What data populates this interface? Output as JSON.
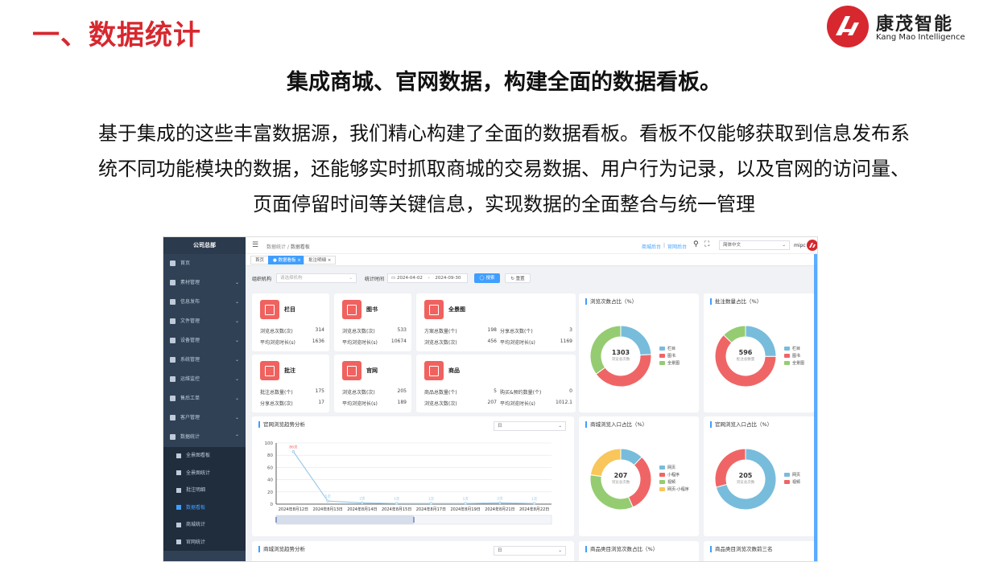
{
  "slide": {
    "title": "一、数据统计",
    "logo_cn": "康茂智能",
    "logo_en": "Kang Mao Intelligence",
    "subtitle": "集成商城、官网数据，构建全面的数据看板。",
    "para_lines": [
      "基于集成的这些丰富数据源，我们精心构建了全面的数据看板。看板不仅能够获取到信息发布系",
      "统不同功能模块的数据，还能够实时抓取商城的交易数据、用户行为记录，以及官网的访问量、",
      "页面停留时间等关键信息，实现数据的全面整合与统一管理"
    ]
  },
  "app": {
    "org": "公司总部",
    "breadcrumb": [
      "数据统计",
      "数据看板"
    ],
    "top_links": [
      "商城后台",
      "官网后台"
    ],
    "language": "简体中文",
    "user": "mipc",
    "menu": [
      {
        "label": "首页",
        "arrow": ""
      },
      {
        "label": "素材管理",
        "arrow": "⌄"
      },
      {
        "label": "信息发布",
        "arrow": "⌄"
      },
      {
        "label": "文件管理",
        "arrow": "⌄"
      },
      {
        "label": "设备管理",
        "arrow": "⌄"
      },
      {
        "label": "系统管理",
        "arrow": "⌄"
      },
      {
        "label": "运维监控",
        "arrow": "⌄"
      },
      {
        "label": "售后工单",
        "arrow": "⌄"
      },
      {
        "label": "客户管理",
        "arrow": "⌄"
      },
      {
        "label": "数据统计",
        "arrow": "⌃"
      }
    ],
    "submenu": [
      "全景图看板",
      "全景图统计",
      "批注明细",
      "数据看板",
      "商城统计",
      "官网统计"
    ],
    "active_submenu": 3,
    "tabs": [
      "首页",
      "● 数据看板 ×",
      "批注明细 ×"
    ],
    "filter": {
      "org_label": "组织机构",
      "org_placeholder": "请选择机构",
      "time_label": "统计时间",
      "date_start": "2024-04-02",
      "date_sep": "-",
      "date_end": "2024-09-30",
      "search_btn": "◯ 搜索",
      "reset_btn": "↻ 重置"
    }
  },
  "stat_cards": [
    {
      "title": "栏目",
      "rows": [
        [
          "浏览总次数(次)",
          "314"
        ],
        [
          "平均浏览时长(s)",
          "1636"
        ]
      ]
    },
    {
      "title": "图书",
      "rows": [
        [
          "浏览总次数(次)",
          "533"
        ],
        [
          "平均浏览时长(s)",
          "10674"
        ]
      ]
    },
    {
      "title": "全景图",
      "rows": [
        [
          "方案总数量(个)",
          "198",
          "分享总次数(个)",
          "3"
        ],
        [
          "浏览总次数(次)",
          "456",
          "平均浏览时长(s)",
          "1169"
        ]
      ]
    },
    {
      "title": "批注",
      "rows": [
        [
          "批注总数量(个)",
          "175"
        ],
        [
          "分享总次数(次)",
          "17"
        ]
      ]
    },
    {
      "title": "官网",
      "rows": [
        [
          "浏览总次数(次)",
          "205"
        ],
        [
          "平均浏览时长(s)",
          "189"
        ]
      ]
    },
    {
      "title": "商品",
      "rows": [
        [
          "商品总数量(个)",
          "5",
          "购买&预约数量(个)",
          "0"
        ],
        [
          "浏览总次数(次)",
          "207",
          "平均浏览时长(s)",
          "1012.1"
        ]
      ]
    }
  ],
  "donuts": [
    {
      "title": "浏览次数占比（%）",
      "total": "1303",
      "center_label": "浏览总次数",
      "legend": [
        "栏目",
        "图书",
        "全景图"
      ],
      "colors": [
        "#78bcdc",
        "#ef6566",
        "#95cc72"
      ],
      "values": [
        314,
        533,
        456
      ]
    },
    {
      "title": "批注数量占比（%）",
      "total": "596",
      "center_label": "批注总数量",
      "legend": [
        "栏目",
        "图书",
        "全景图"
      ],
      "colors": [
        "#78bcdc",
        "#ef6566",
        "#95cc72"
      ],
      "values": [
        150,
        370,
        76
      ]
    },
    {
      "title": "商城浏览入口占比（%）",
      "total": "207",
      "center_label": "浏览总次数",
      "legend": [
        "网页",
        "小程序",
        "视频",
        "网页-小程序"
      ],
      "colors": [
        "#78bcdc",
        "#ef6566",
        "#95cc72",
        "#f8c65a"
      ],
      "values": [
        25,
        65,
        70,
        47
      ]
    },
    {
      "title": "官网浏览入口占比（%）",
      "total": "205",
      "center_label": "浏览总次数",
      "legend": [
        "网页",
        "视频"
      ],
      "colors": [
        "#78bcdc",
        "#ef6566"
      ],
      "values": [
        145,
        60
      ]
    }
  ],
  "trend": {
    "title": "官网浏览趋势分析",
    "period": "日",
    "bottom_title": "商城浏览趋势分析",
    "bottom_period": "日"
  },
  "bottom_cards": [
    "商品类目浏览次数占比（%）",
    "商品类目浏览次数前三名"
  ],
  "chart_data": {
    "type": "line",
    "title": "官网浏览趋势分析",
    "x": [
      "2024年8月12日",
      "2024年8月13日",
      "2024年8月14日",
      "2024年8月15日",
      "2024年8月17日",
      "2024年8月19日",
      "2024年8月21日",
      "2024年8月22日"
    ],
    "values": [
      86,
      5,
      2,
      1,
      1,
      1,
      2,
      1
    ],
    "data_labels": [
      "86次",
      "5次",
      "2次",
      "1次",
      "1次",
      "1次",
      "2次",
      "1次"
    ],
    "ylim": [
      0,
      100
    ],
    "yticks": [
      "0",
      "20",
      "40",
      "60",
      "80",
      "100"
    ],
    "grid": true,
    "color": "#9ccbe9"
  }
}
